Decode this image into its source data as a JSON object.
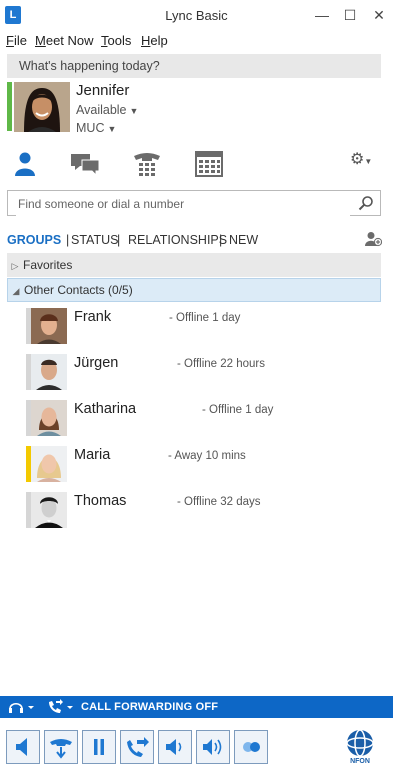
{
  "window": {
    "title": "Lync Basic",
    "app_icon_letter": "L",
    "minimize": "—",
    "maximize": "☐",
    "close": "✕"
  },
  "menu": {
    "file": "File",
    "meet_now": "Meet Now",
    "tools": "Tools",
    "help": "Help"
  },
  "status_message": {
    "placeholder": "What's happening today?"
  },
  "me": {
    "name": "Jennifer",
    "availability": "Available",
    "location": "MUC",
    "presence_color": "#5fb847"
  },
  "search": {
    "placeholder": "Find someone or dial a number"
  },
  "view_tabs": {
    "groups": "GROUPS",
    "status": "STATUS",
    "relationships": "RELATIONSHIPS",
    "new": "NEW"
  },
  "groups": [
    {
      "label": "Favorites",
      "expanded": false
    },
    {
      "label": "Other Contacts (0/5)",
      "expanded": true
    }
  ],
  "contacts": [
    {
      "name": "Frank",
      "status": "- Offline 1 day",
      "presence_color": "#d6d6d6"
    },
    {
      "name": "Jürgen",
      "status": "- Offline 22 hours",
      "presence_color": "#d6d6d6"
    },
    {
      "name": "Katharina",
      "status": "- Offline 1 day",
      "presence_color": "#d6d6d6"
    },
    {
      "name": "Maria",
      "status": "- Away 10 mins",
      "presence_color": "#f3c900"
    },
    {
      "name": "Thomas",
      "status": "- Offline 32 days",
      "presence_color": "#d6d6d6"
    }
  ],
  "call_forwarding": {
    "label": "CALL FORWARDING OFF"
  },
  "brand": {
    "logo_text": "NFON",
    "accent": "#0d67c6"
  }
}
